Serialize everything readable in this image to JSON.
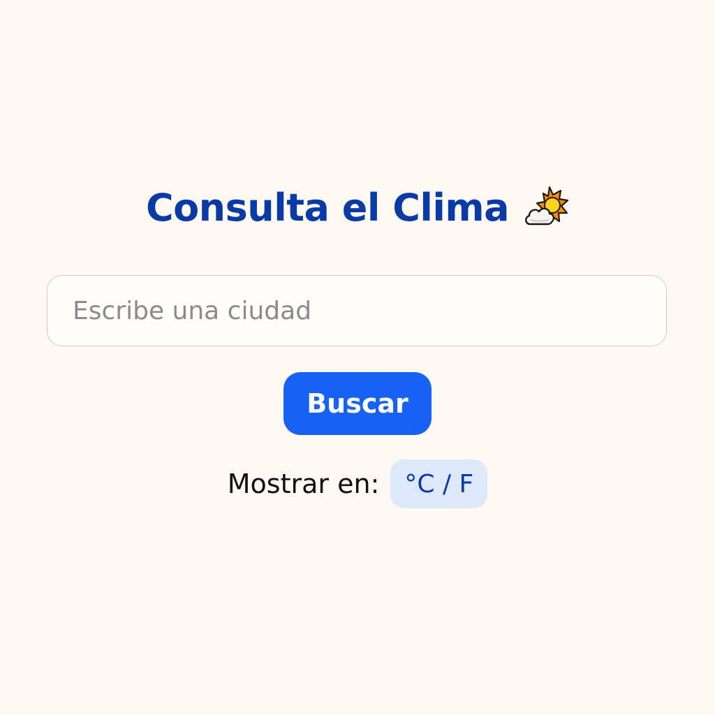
{
  "header": {
    "title": "Consulta el Clima",
    "icon": "sun-behind-cloud-icon"
  },
  "search": {
    "placeholder": "Escribe una ciudad",
    "value": "",
    "button_label": "Buscar"
  },
  "units": {
    "label": "Mostrar en:",
    "toggle_label": "°C / F"
  },
  "colors": {
    "background": "#fdf8f2",
    "title": "#0a3aa6",
    "button": "#1762f5",
    "toggle_bg": "#dde9fb"
  }
}
